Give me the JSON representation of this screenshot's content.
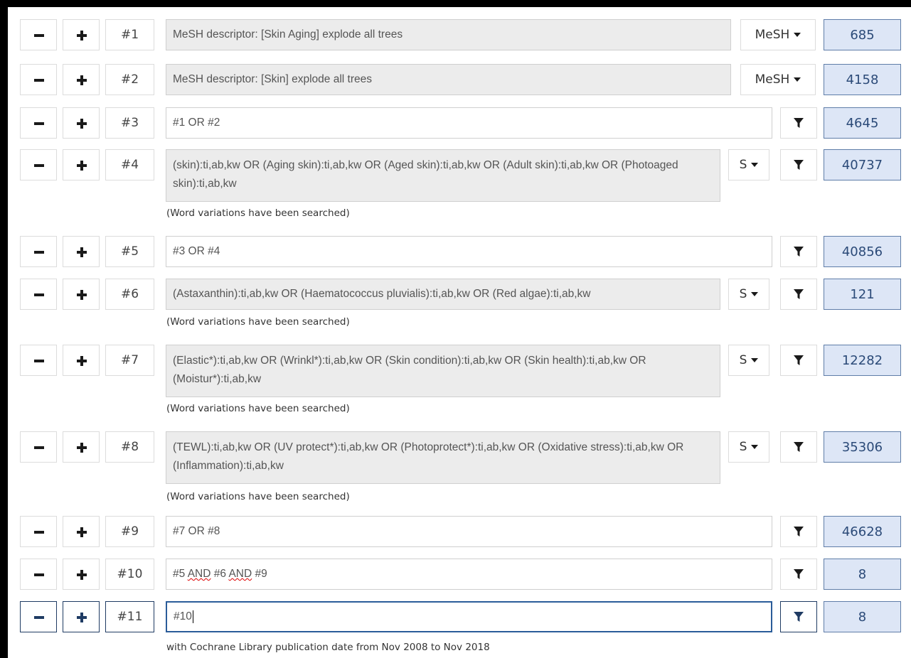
{
  "rows": [
    {
      "id": "#1",
      "query": "MeSH descriptor: [Skin Aging] explode all trees",
      "field": "MeSH",
      "count": "685"
    },
    {
      "id": "#2",
      "query": "MeSH descriptor: [Skin] explode all trees",
      "field": "MeSH",
      "count": "4158"
    },
    {
      "id": "#3",
      "query": "#1 OR #2",
      "count": "4645"
    },
    {
      "id": "#4",
      "query": "(skin):ti,ab,kw OR (Aging skin):ti,ab,kw OR (Aged skin):ti,ab,kw OR (Adult skin):ti,ab,kw OR (Photoaged skin):ti,ab,kw",
      "field": "S",
      "count": "40737",
      "note": "(Word variations have been searched)"
    },
    {
      "id": "#5",
      "query": "#3 OR #4",
      "count": "40856"
    },
    {
      "id": "#6",
      "query": "(Astaxanthin):ti,ab,kw OR (Haematococcus pluvialis):ti,ab,kw OR (Red algae):ti,ab,kw",
      "field": "S",
      "count": "121",
      "note": "(Word variations have been searched)"
    },
    {
      "id": "#7",
      "query": "(Elastic*):ti,ab,kw OR (Wrinkl*):ti,ab,kw OR (Skin condition):ti,ab,kw OR (Skin health):ti,ab,kw OR (Moistur*):ti,ab,kw",
      "field": "S",
      "count": "12282",
      "note": "(Word variations have been searched)"
    },
    {
      "id": "#8",
      "query": "(TEWL):ti,ab,kw OR (UV protect*):ti,ab,kw OR (Photoprotect*):ti,ab,kw OR (Oxidative stress):ti,ab,kw OR (Inflammation):ti,ab,kw",
      "field": "S",
      "count": "35306",
      "note": "(Word variations have been searched)"
    },
    {
      "id": "#9",
      "query": "#7 OR #8",
      "count": "46628"
    },
    {
      "id": "#10",
      "query_parts": [
        "#5 ",
        "AND",
        " #6 ",
        "AND",
        " #9"
      ],
      "count": "8"
    },
    {
      "id": "#11",
      "query": "#10",
      "count": "8",
      "note": "with Cochrane Library publication date from Nov 2008 to Nov 2018"
    }
  ],
  "colors": {
    "count_bg": "#dde6f6",
    "count_text": "#2b4a78",
    "active_border": "#2a5c99"
  },
  "icons": {
    "remove": "minus-icon",
    "add": "plus-icon",
    "filter": "filter-icon",
    "dropdown": "caret-down-icon"
  }
}
